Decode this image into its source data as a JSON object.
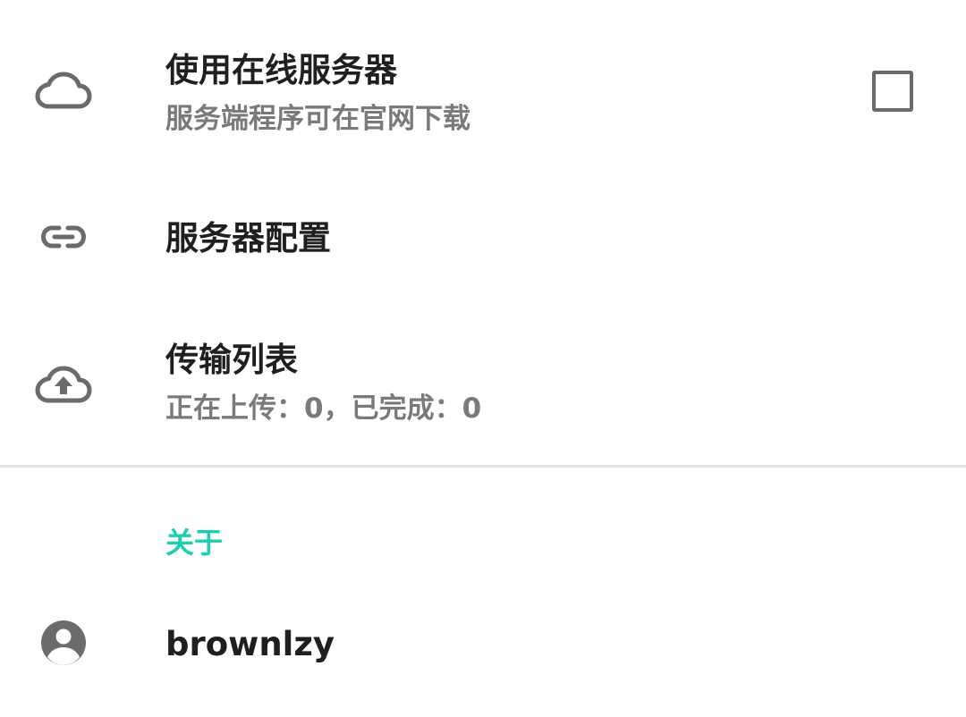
{
  "settings": {
    "online_server": {
      "title": "使用在线服务器",
      "subtitle": "服务端程序可在官网下载",
      "icon": "cloud-icon",
      "checked": false
    },
    "server_config": {
      "title": "服务器配置",
      "icon": "link-icon"
    },
    "transfer_list": {
      "title": "传输列表",
      "subtitle": "正在上传：0，已完成：0",
      "icon": "cloud-upload-icon"
    }
  },
  "about": {
    "header": "关于",
    "author": {
      "name": "brownlzy",
      "icon": "account-circle-icon"
    }
  },
  "colors": {
    "accent": "#1ccfb0",
    "title_text": "#1f1f1f",
    "subtitle_text": "#7a7a7a",
    "icon": "#6b6b6b",
    "divider": "#e3e3e3"
  }
}
